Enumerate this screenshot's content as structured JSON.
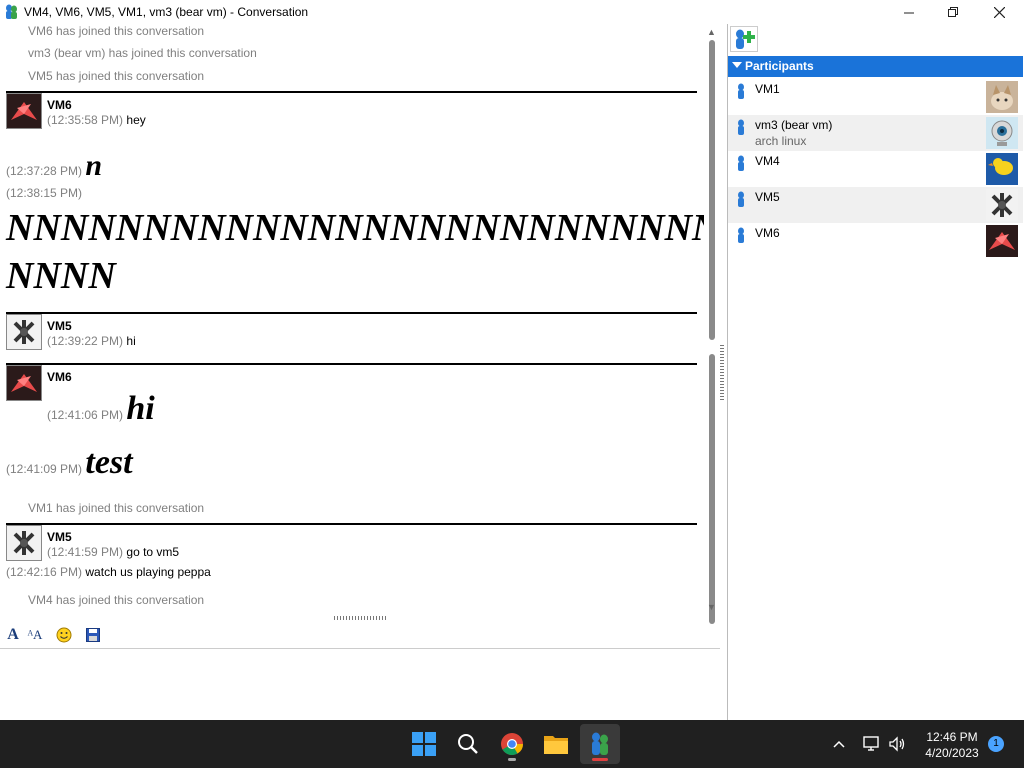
{
  "window": {
    "title": "VM4, VM6, VM5, VM1, vm3 (bear vm) - Conversation",
    "minimize_icon": "minimize-icon",
    "maximize_icon": "restore-icon",
    "close_icon": "close-icon"
  },
  "chat": {
    "sys1": "VM6 has joined this conversation",
    "sys2": "vm3 (bear vm) has joined this conversation",
    "sys3": "VM5 has joined this conversation",
    "msg1": {
      "sender": "VM6",
      "ts": "(12:35:58 PM)",
      "text": "hey"
    },
    "msg2": {
      "ts": "(12:37:28 PM)",
      "text": "n"
    },
    "msg3": {
      "ts": "(12:38:15 PM)",
      "text_line1": "NNNNNNNNNNNNNNNNNNNNNNNNNNNN",
      "text_line2": "NNNN"
    },
    "msg4": {
      "sender": "VM5",
      "ts": "(12:39:22 PM)",
      "text": "hi"
    },
    "msg5": {
      "sender": "VM6",
      "ts": "(12:41:06 PM)",
      "text": "hi"
    },
    "msg6": {
      "ts": "(12:41:09 PM)",
      "text": "test"
    },
    "sys4": "VM1 has joined this conversation",
    "msg7": {
      "sender": "VM5",
      "ts": "(12:41:59 PM)",
      "text": "go to vm5"
    },
    "msg8": {
      "ts": "(12:42:16 PM)",
      "text": "watch us playing peppa"
    },
    "sys5": "VM4 has joined this conversation"
  },
  "format_toolbar": {
    "items": [
      "font-icon",
      "font-size-icon",
      "smiley-icon",
      "save-icon"
    ]
  },
  "participants": {
    "header": "Participants",
    "invite_icon": "invite-user-icon",
    "list": [
      {
        "name": "VM1",
        "status": "",
        "avatar": "cat-avatar"
      },
      {
        "name": "vm3 (bear vm)",
        "status": "arch linux",
        "avatar": "webcam-avatar"
      },
      {
        "name": "VM4",
        "status": "",
        "avatar": "duck-avatar"
      },
      {
        "name": "VM5",
        "status": "",
        "avatar": "jacks-avatar"
      },
      {
        "name": "VM6",
        "status": "",
        "avatar": "crane-avatar"
      }
    ]
  },
  "taskbar": {
    "apps": [
      "windows-start-icon",
      "search-icon",
      "chrome-icon",
      "file-explorer-icon",
      "pidgin-icon"
    ],
    "tray": [
      "chevron-up-icon",
      "network-icon",
      "volume-icon"
    ],
    "time": "12:46 PM",
    "date": "4/20/2023",
    "notification_count": "1"
  },
  "colors": {
    "participants_header": "#1a73d9",
    "timestamp": "#808080",
    "taskbar": "#202020"
  }
}
